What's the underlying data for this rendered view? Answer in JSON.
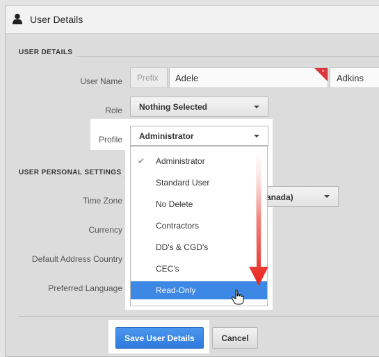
{
  "header": {
    "title": "User Details",
    "icon": "user-icon"
  },
  "sections": {
    "user_details": "USER DETAILS",
    "personal_settings": "USER PERSONAL SETTINGS"
  },
  "fields": {
    "user_name": {
      "label": "User Name",
      "prefix_placeholder": "Prefix",
      "first_name": "Adele",
      "last_name": "Adkins"
    },
    "role": {
      "label": "Role",
      "value": "Nothing Selected"
    },
    "profile": {
      "label": "Profile",
      "value": "Administrator"
    },
    "time_zone": {
      "label": "Time Zone",
      "value_visible": "anada)"
    },
    "currency": {
      "label": "Currency"
    },
    "default_address_country": {
      "label": "Default Address Country"
    },
    "preferred_language": {
      "label": "Preferred Language"
    }
  },
  "profile_menu": {
    "items": [
      {
        "label": "Administrator",
        "checked": true
      },
      {
        "label": "Standard User"
      },
      {
        "label": "No Delete"
      },
      {
        "label": "Contractors"
      },
      {
        "label": "DD's & CGD's"
      },
      {
        "label": "CEC's"
      },
      {
        "label": "Read-Only",
        "highlighted": true
      }
    ]
  },
  "footer": {
    "save_label": "Save User Details",
    "cancel_label": "Cancel"
  },
  "colors": {
    "accent": "#3d87e5",
    "arrow": "#e8221b",
    "required_flag": "#d9363e"
  }
}
